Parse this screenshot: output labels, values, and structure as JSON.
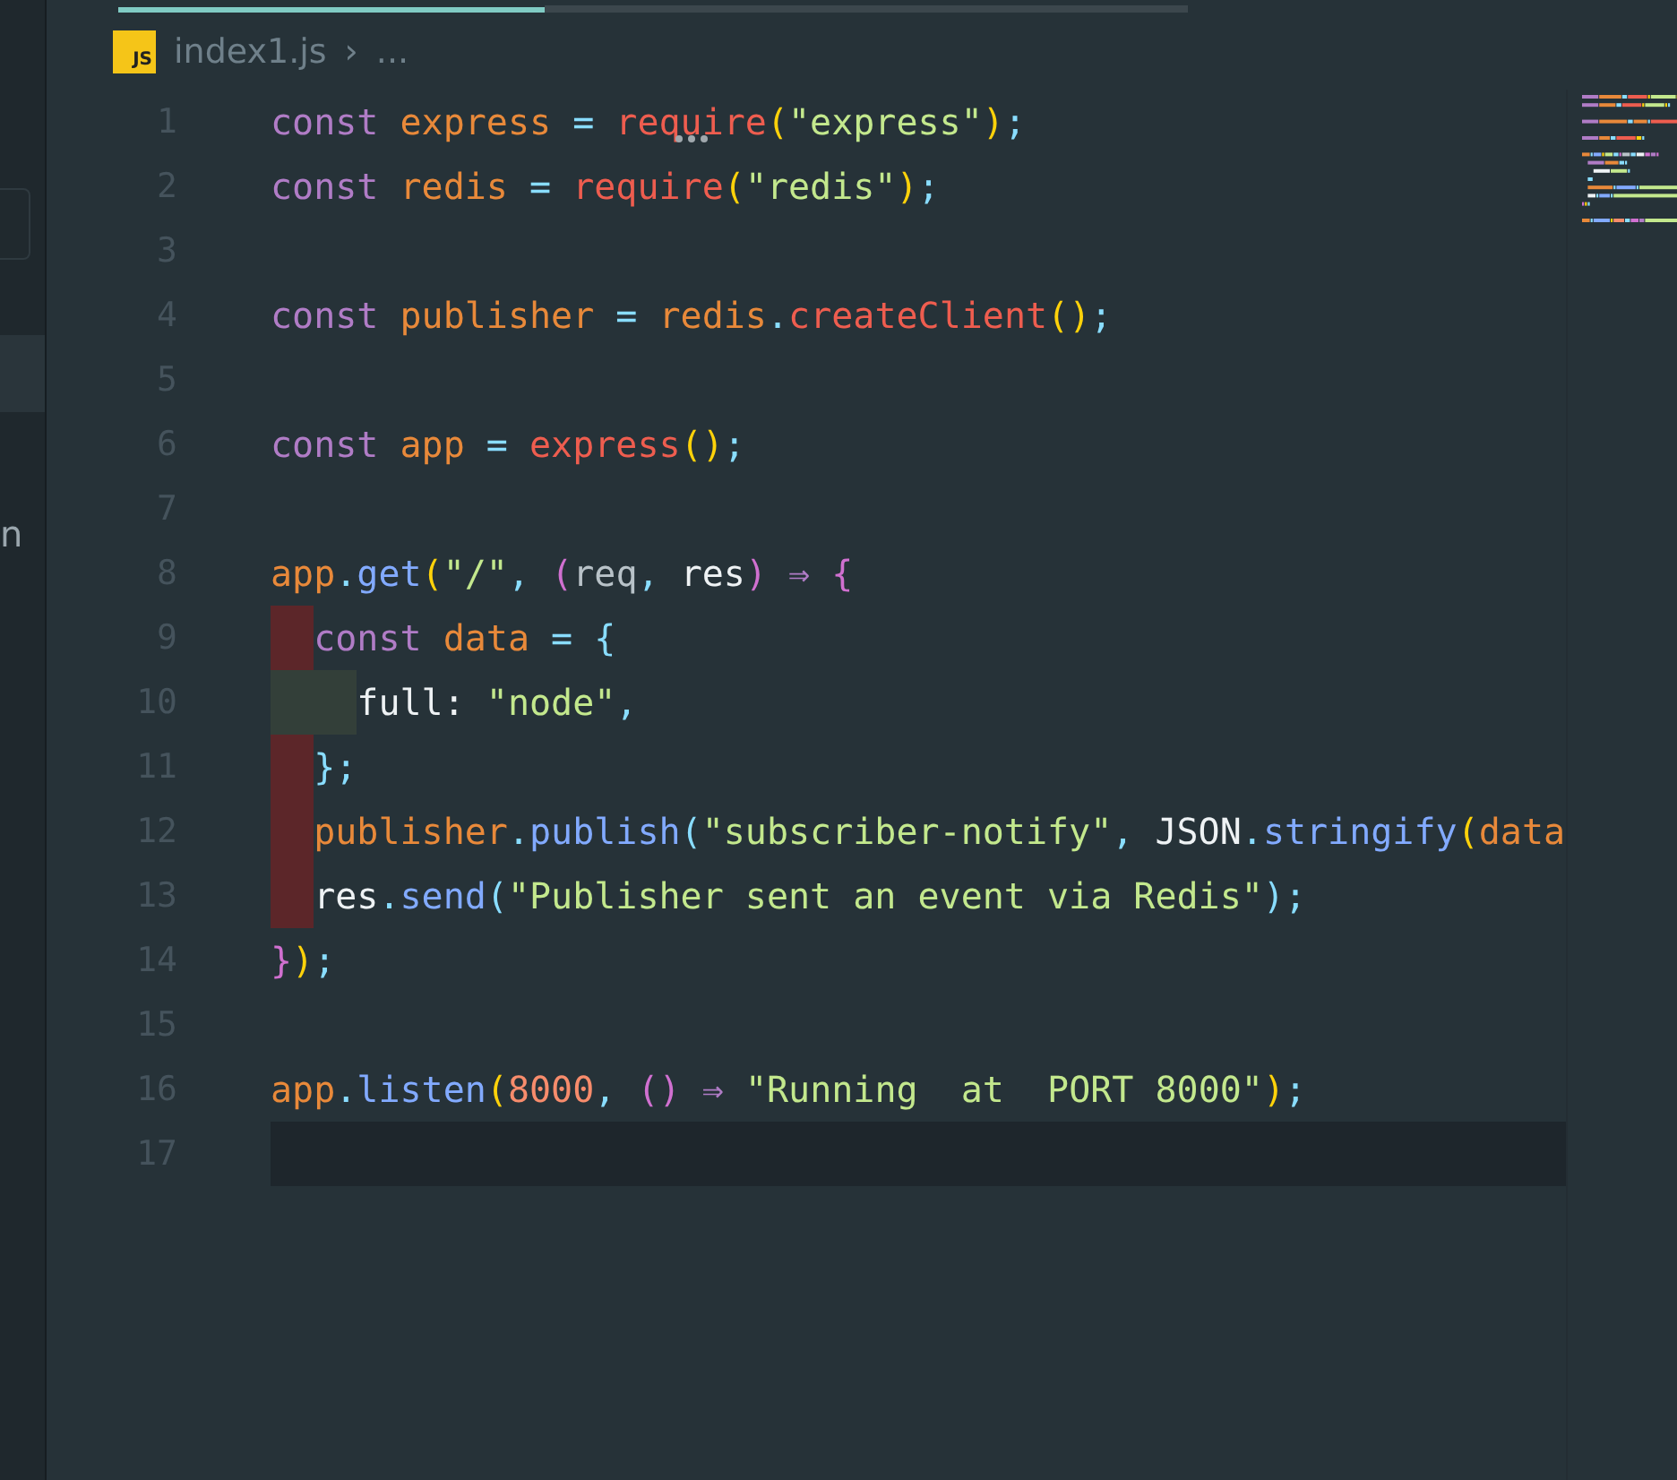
{
  "sidebar": {
    "items": [
      {
        "label": "n"
      }
    ]
  },
  "breadcrumb": {
    "icon_label": "JS",
    "file": "index1.js",
    "separator": "›",
    "more": "..."
  },
  "lines": [
    {
      "number": "1",
      "tokens": [
        {
          "text": "const ",
          "kind": "keyword"
        },
        {
          "text": "express ",
          "kind": "variable"
        },
        {
          "text": "= ",
          "kind": "operator"
        },
        {
          "text": "require",
          "kind": "call",
          "hint": true
        },
        {
          "text": "(",
          "kind": "paren"
        },
        {
          "text": "\"express\"",
          "kind": "string"
        },
        {
          "text": ")",
          "kind": "paren"
        },
        {
          "text": ";",
          "kind": "punct"
        }
      ]
    },
    {
      "number": "2",
      "tokens": [
        {
          "text": "const ",
          "kind": "keyword"
        },
        {
          "text": "redis ",
          "kind": "variable"
        },
        {
          "text": "= ",
          "kind": "operator"
        },
        {
          "text": "require",
          "kind": "call"
        },
        {
          "text": "(",
          "kind": "paren"
        },
        {
          "text": "\"redis\"",
          "kind": "string"
        },
        {
          "text": ")",
          "kind": "paren"
        },
        {
          "text": ";",
          "kind": "punct"
        }
      ]
    },
    {
      "number": "3"
    },
    {
      "number": "4",
      "tokens": [
        {
          "text": "const ",
          "kind": "keyword"
        },
        {
          "text": "publisher ",
          "kind": "variable"
        },
        {
          "text": "= ",
          "kind": "operator"
        },
        {
          "text": "redis",
          "kind": "variable"
        },
        {
          "text": ".",
          "kind": "punct"
        },
        {
          "text": "createClient",
          "kind": "call"
        },
        {
          "text": "()",
          "kind": "paren"
        },
        {
          "text": ";",
          "kind": "punct"
        }
      ]
    },
    {
      "number": "5"
    },
    {
      "number": "6",
      "tokens": [
        {
          "text": "const ",
          "kind": "keyword"
        },
        {
          "text": "app ",
          "kind": "variable"
        },
        {
          "text": "= ",
          "kind": "operator"
        },
        {
          "text": "express",
          "kind": "call"
        },
        {
          "text": "()",
          "kind": "paren"
        },
        {
          "text": ";",
          "kind": "punct"
        }
      ]
    },
    {
      "number": "7"
    },
    {
      "number": "8",
      "tokens": [
        {
          "text": "app",
          "kind": "variable"
        },
        {
          "text": ".",
          "kind": "punct"
        },
        {
          "text": "get",
          "kind": "method"
        },
        {
          "text": "(",
          "kind": "paren"
        },
        {
          "text": "\"/\"",
          "kind": "string"
        },
        {
          "text": ", ",
          "kind": "punct"
        },
        {
          "text": "(",
          "kind": "paren2"
        },
        {
          "text": "req",
          "kind": "param"
        },
        {
          "text": ", ",
          "kind": "punct"
        },
        {
          "text": "res",
          "kind": "plain"
        },
        {
          "text": ") ",
          "kind": "paren2"
        },
        {
          "text": "⇒ ",
          "kind": "keyword"
        },
        {
          "text": "{",
          "kind": "paren2"
        }
      ]
    },
    {
      "number": "9",
      "kind": "indent_error",
      "tokens": [
        {
          "text": "const ",
          "kind": "keyword"
        },
        {
          "text": "data ",
          "kind": "variable"
        },
        {
          "text": "= ",
          "kind": "operator"
        },
        {
          "text": "{",
          "kind": "brace"
        }
      ]
    },
    {
      "number": "10",
      "kind": "indent_ok",
      "tokens": [
        {
          "text": "full: ",
          "kind": "plain"
        },
        {
          "text": "\"node\"",
          "kind": "string"
        },
        {
          "text": ",",
          "kind": "punct"
        }
      ]
    },
    {
      "number": "11",
      "kind": "indent_error",
      "tokens": [
        {
          "text": "};",
          "kind": "brace"
        }
      ]
    },
    {
      "number": "12",
      "kind": "indent_error",
      "tokens": [
        {
          "text": "publisher",
          "kind": "variable"
        },
        {
          "text": ".",
          "kind": "punct"
        },
        {
          "text": "publish",
          "kind": "method"
        },
        {
          "text": "(",
          "kind": "brace"
        },
        {
          "text": "\"subscriber-notify\"",
          "kind": "string"
        },
        {
          "text": ", ",
          "kind": "punct"
        },
        {
          "text": "JSON",
          "kind": "plain"
        },
        {
          "text": ".",
          "kind": "punct"
        },
        {
          "text": "stringify",
          "kind": "method"
        },
        {
          "text": "(",
          "kind": "paren"
        },
        {
          "text": "data",
          "kind": "variable"
        }
      ]
    },
    {
      "number": "13",
      "kind": "indent_error",
      "tokens": [
        {
          "text": "res",
          "kind": "plain"
        },
        {
          "text": ".",
          "kind": "punct"
        },
        {
          "text": "send",
          "kind": "method"
        },
        {
          "text": "(",
          "kind": "brace"
        },
        {
          "text": "\"Publisher sent an event via Redis\"",
          "kind": "string"
        },
        {
          "text": ");",
          "kind": "brace"
        }
      ]
    },
    {
      "number": "14",
      "tokens": [
        {
          "text": "}",
          "kind": "paren2"
        },
        {
          "text": ")",
          "kind": "paren"
        },
        {
          "text": ";",
          "kind": "punct"
        }
      ]
    },
    {
      "number": "15"
    },
    {
      "number": "16",
      "tokens": [
        {
          "text": "app",
          "kind": "variable"
        },
        {
          "text": ".",
          "kind": "punct"
        },
        {
          "text": "listen",
          "kind": "method"
        },
        {
          "text": "(",
          "kind": "paren"
        },
        {
          "text": "8000",
          "kind": "number"
        },
        {
          "text": ", ",
          "kind": "punct"
        },
        {
          "text": "() ",
          "kind": "paren2"
        },
        {
          "text": "⇒ ",
          "kind": "keyword"
        },
        {
          "text": "\"Running  at  PORT 8000\"",
          "kind": "string"
        },
        {
          "text": ")",
          "kind": "paren"
        },
        {
          "text": ";",
          "kind": "punct"
        }
      ]
    },
    {
      "number": "17",
      "current": true
    }
  ]
}
